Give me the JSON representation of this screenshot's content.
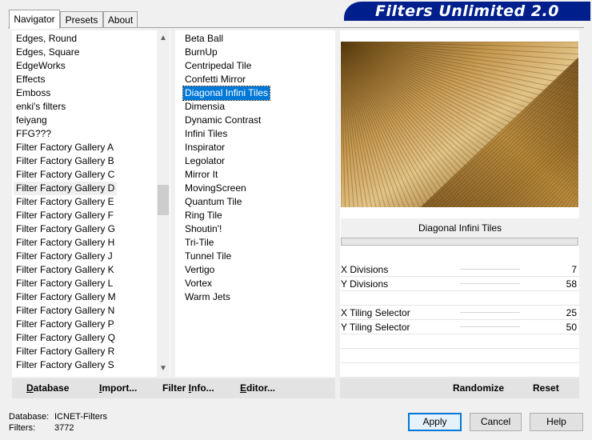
{
  "banner": {
    "title": "Filters Unlimited 2.0"
  },
  "tabs": [
    {
      "label": "Navigator"
    },
    {
      "label": "Presets"
    },
    {
      "label": "About"
    }
  ],
  "categories": [
    "Edges, Round",
    "Edges, Square",
    "EdgeWorks",
    "Effects",
    "Emboss",
    "enki's filters",
    "feiyang",
    "FFG???",
    "Filter Factory Gallery A",
    "Filter Factory Gallery B",
    "Filter Factory Gallery C",
    "Filter Factory Gallery D",
    "Filter Factory Gallery E",
    "Filter Factory Gallery F",
    "Filter Factory Gallery G",
    "Filter Factory Gallery H",
    "Filter Factory Gallery J",
    "Filter Factory Gallery K",
    "Filter Factory Gallery L",
    "Filter Factory Gallery M",
    "Filter Factory Gallery N",
    "Filter Factory Gallery P",
    "Filter Factory Gallery Q",
    "Filter Factory Gallery R",
    "Filter Factory Gallery S"
  ],
  "selected_category": "Filter Factory Gallery D",
  "filters": [
    "Beta Ball",
    "BurnUp",
    "Centripedal Tile",
    "Confetti Mirror",
    "Diagonal Infini Tiles",
    "Dimensia",
    "Dynamic Contrast",
    "Infini Tiles",
    "Inspirator",
    "Legolator",
    "Mirror It",
    "MovingScreen",
    "Quantum Tile",
    "Ring Tile",
    "Shoutin'!",
    "Tri-Tile",
    "Tunnel Tile",
    "Vertigo",
    "Vortex",
    "Warm Jets"
  ],
  "selected_filter": "Diagonal Infini Tiles",
  "preview": {
    "filter_name": "Diagonal Infini Tiles"
  },
  "params": [
    {
      "label": "X Divisions",
      "value": "7"
    },
    {
      "label": "Y Divisions",
      "value": "58"
    },
    {
      "label": "X Tiling Selector",
      "value": "25"
    },
    {
      "label": "Y Tiling Selector",
      "value": "50"
    }
  ],
  "left_toolbar": {
    "database": {
      "u": "D",
      "rest": "atabase"
    },
    "import": {
      "u": "I",
      "rest": "mport..."
    },
    "filter_info": {
      "pre": "Filter ",
      "u": "I",
      "rest": "nfo..."
    },
    "editor": {
      "u": "E",
      "rest": "ditor..."
    }
  },
  "right_toolbar": {
    "randomize": "Randomize",
    "reset": "Reset"
  },
  "status": {
    "database_label": "Database:",
    "database_value": "ICNET-Filters",
    "filters_label": "Filters:",
    "filters_value": "3772"
  },
  "buttons": {
    "apply": "Apply",
    "cancel": "Cancel",
    "help": "Help"
  },
  "colors": {
    "banner": "#001f8c",
    "selection": "#0078d7",
    "preview_dark": "#5a3c10",
    "preview_light": "#e8c98a"
  }
}
